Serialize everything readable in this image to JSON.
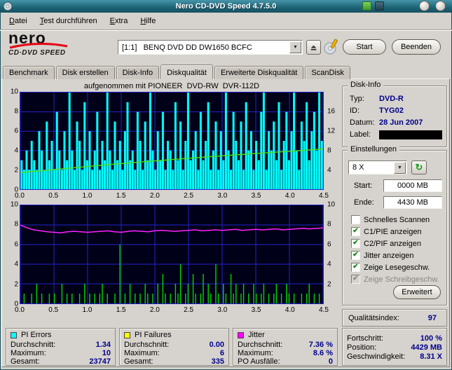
{
  "window": {
    "title": "Nero CD-DVD Speed 4.7.5.0"
  },
  "menu": {
    "items": [
      "Datei",
      "Test durchführen",
      "Extra",
      "Hilfe"
    ]
  },
  "toolbar": {
    "logo_top": "nero",
    "logo_bottom": "CD·DVD SPEED",
    "drive_value": "[1:1]   BENQ DVD DD DW1650 BCFC",
    "start_label": "Start",
    "quit_label": "Beenden"
  },
  "tabs": [
    {
      "label": "Benchmark",
      "active": false
    },
    {
      "label": "Disk erstellen",
      "active": false
    },
    {
      "label": "Disk-Info",
      "active": false
    },
    {
      "label": "Diskqualität",
      "active": true
    },
    {
      "label": "Erweiterte Diskqualität",
      "active": false
    },
    {
      "label": "ScanDisk",
      "active": false
    }
  ],
  "disk_info": {
    "title": "Disk-Info",
    "typ_label": "Typ:",
    "typ_value": "DVD-R",
    "id_label": "ID:",
    "id_value": "TYG02",
    "datum_label": "Datum:",
    "datum_value": "28 Jun 2007",
    "label_label": "Label:",
    "label_value": ""
  },
  "settings": {
    "title": "Einstellungen",
    "speed_value": "8 X",
    "start_label": "Start:",
    "start_value": "0000 MB",
    "end_label": "Ende:",
    "end_value": "4430 MB",
    "checkboxes": [
      {
        "label": "Schnelles Scannen",
        "checked": false,
        "enabled": true
      },
      {
        "label": "C1/PIE anzeigen",
        "checked": true,
        "enabled": true
      },
      {
        "label": "C2/PIF anzeigen",
        "checked": true,
        "enabled": true
      },
      {
        "label": "Jitter anzeigen",
        "checked": true,
        "enabled": true
      },
      {
        "label": "Zeige Lesegeschw.",
        "checked": true,
        "enabled": true
      },
      {
        "label": "Zeige Schreibgeschw.",
        "checked": true,
        "enabled": false
      }
    ],
    "advanced_label": "Erweitert"
  },
  "quality": {
    "label": "Qualitätsindex:",
    "value": "97"
  },
  "stats_panels": [
    {
      "title": "PI Errors",
      "swatch": "#00ffff",
      "rows": [
        [
          "Durchschnitt:",
          "1.34"
        ],
        [
          "Maximum:",
          "10"
        ],
        [
          "Gesamt:",
          "23747"
        ]
      ]
    },
    {
      "title": "PI Failures",
      "swatch": "#ffff00",
      "rows": [
        [
          "Durchschnitt:",
          "0.00"
        ],
        [
          "Maximum:",
          "6"
        ],
        [
          "Gesamt:",
          "335"
        ]
      ]
    },
    {
      "title": "Jitter",
      "swatch": "#ff00ff",
      "rows": [
        [
          "Durchschnitt:",
          "7.36 %"
        ],
        [
          "Maximum:",
          "8.6 %"
        ],
        [
          "PO Ausfälle:",
          "0"
        ]
      ]
    },
    {
      "title": "",
      "swatch": "",
      "rows": [
        [
          "Fortschritt:",
          "100 %"
        ],
        [
          "Position:",
          "4429 MB"
        ],
        [
          "Geschwindigkeit:",
          "8.31 X"
        ]
      ]
    }
  ],
  "chart_data": [
    {
      "type": "bar",
      "name": "PI Errors mit Lesegeschwindigkeit",
      "annotation": "aufgenommen mit PIONEER  DVD-RW  DVR-112D",
      "x_unit": "GB",
      "xlim": [
        0,
        4.5
      ],
      "x_ticks": [
        0,
        0.5,
        1,
        1.5,
        2,
        2.5,
        3,
        3.5,
        4,
        4.5
      ],
      "ylim_left": [
        0,
        10
      ],
      "yticks_left": [
        10,
        8,
        6,
        4,
        2,
        0
      ],
      "yticks_right": [
        16,
        12,
        8,
        4
      ],
      "right_axis_scale": 2,
      "grid_y": [
        2,
        4,
        6,
        8
      ],
      "bg": "#000018",
      "grid_color": "#2323cf",
      "bar_color": "#00ffff",
      "bar_width_frac": 0.85,
      "bar_series_name": "PI Errors",
      "bars": [
        3,
        2,
        4,
        2,
        5,
        3,
        2,
        6,
        4,
        2,
        7,
        3,
        5,
        2,
        8,
        4,
        2,
        6,
        3,
        10,
        4,
        2,
        7,
        5,
        2,
        9,
        3,
        6,
        2,
        4,
        8,
        2,
        5,
        3,
        10,
        4,
        2,
        7,
        3,
        5,
        2,
        6,
        9,
        3,
        4,
        2,
        8,
        5,
        2,
        7,
        3,
        10,
        4,
        2,
        6,
        3,
        8,
        2,
        5,
        4,
        2,
        9,
        3,
        7,
        2,
        5,
        10,
        3,
        4,
        6,
        2,
        8,
        3,
        5,
        9,
        2,
        4,
        7,
        2,
        6,
        3,
        10,
        4,
        2,
        8,
        5,
        3,
        7,
        2,
        9,
        4,
        6,
        2,
        5,
        3,
        8,
        10,
        2,
        6,
        4,
        7,
        3,
        9,
        2,
        5,
        8,
        3,
        6,
        10,
        4,
        2,
        7,
        5,
        9,
        3,
        6,
        8,
        4,
        10,
        5
      ],
      "lines": [
        {
          "name": "Lesegeschwindigkeit",
          "color": "#55dd22",
          "axis": "right",
          "values": [
            3.44,
            4.05,
            4.7,
            5.3,
            5.85,
            6.4,
            6.9,
            7.4,
            7.85,
            8.31
          ]
        }
      ]
    },
    {
      "type": "bar",
      "name": "PI Failures mit Jitter",
      "annotation": "",
      "x_unit": "GB",
      "xlim": [
        0,
        4.5
      ],
      "x_ticks": [
        0,
        0.5,
        1,
        1.5,
        2,
        2.5,
        3,
        3.5,
        4,
        4.5
      ],
      "ylim_left": [
        0,
        10
      ],
      "yticks_left": [
        10,
        8,
        6,
        4,
        2,
        0
      ],
      "yticks_right": [
        10,
        8,
        6,
        4,
        2
      ],
      "right_axis_scale": 1,
      "grid_y": [
        2,
        4,
        6,
        8
      ],
      "bg": "#000018",
      "grid_color": "#2323cf",
      "bar_color": "#00d400",
      "bar_width_frac": 0.4,
      "bar_series_name": "PI Failures",
      "bars": [
        0,
        1,
        0,
        0,
        1,
        0,
        2,
        0,
        1,
        0,
        0,
        1,
        0,
        1,
        0,
        0,
        2,
        0,
        1,
        0,
        1,
        0,
        0,
        1,
        0,
        2,
        0,
        1,
        0,
        1,
        0,
        1,
        2,
        0,
        1,
        0,
        0,
        1,
        0,
        6,
        0,
        1,
        0,
        2,
        0,
        1,
        0,
        1,
        0,
        2,
        1,
        0,
        1,
        0,
        2,
        0,
        3,
        1,
        0,
        1,
        0,
        2,
        1,
        4,
        0,
        1,
        2,
        0,
        3,
        1,
        0,
        1,
        3,
        0,
        2,
        1,
        0,
        4,
        1,
        0,
        2,
        1,
        0,
        3,
        1,
        2,
        0,
        1,
        2,
        0,
        1,
        0,
        2,
        1,
        0,
        1,
        2,
        0,
        1,
        0,
        1,
        2,
        0,
        1,
        0,
        2,
        1,
        0,
        1,
        0,
        0,
        1,
        0,
        1,
        2,
        0,
        1,
        0,
        1,
        0
      ],
      "lines": [
        {
          "name": "Jitter",
          "color": "#ff22ff",
          "axis": "left",
          "values": [
            8.0,
            7.7,
            7.5,
            7.4,
            7.3,
            7.25,
            7.2,
            7.3,
            7.35,
            7.3,
            7.25,
            7.3,
            7.35,
            7.4,
            7.3,
            7.25,
            7.35,
            7.4,
            7.35,
            7.3,
            7.4,
            7.45,
            7.4,
            7.35,
            7.4,
            7.45,
            7.5,
            7.4,
            7.45,
            7.5,
            7.45,
            7.5,
            7.55,
            7.45,
            7.5,
            7.55,
            7.5,
            7.55,
            7.6,
            7.5,
            7.55,
            7.6,
            7.65,
            7.6,
            7.65,
            7.7
          ]
        }
      ]
    }
  ]
}
